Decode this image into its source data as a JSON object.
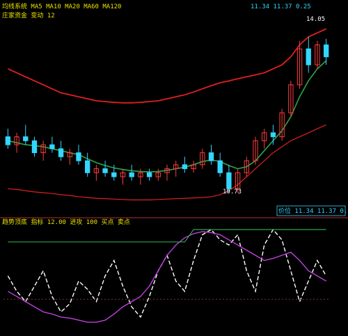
{
  "header": {
    "title_line": "均线系统 MA5 MA10 MA20 MA60 MA120",
    "sub_line": "庄家资金 变动 12",
    "right_line": "11.34 11.37 0.25"
  },
  "upper_panel": {
    "price_readout_high": "14.05",
    "price_readout_low": "10.73",
    "scale_box": "价位 11.34 11.37 0.25"
  },
  "lower_panel": {
    "title_line": "趋势顶底 指标 12.00 进攻 100 买点 卖点"
  },
  "colors": {
    "background": "#000000",
    "up_candle": "#ff3b3b",
    "down_candle": "#33d6ff",
    "band_red": "#e02020",
    "band_green": "#2aa84a",
    "ma_main": "#e8e000",
    "trend_white": "#ffffff",
    "trend_magenta": "#c040e0",
    "trend_green": "#2aa84a",
    "panel_border": "#b03030",
    "grid_dot": "#6a2a2a"
  },
  "chart_data": [
    {
      "type": "candlestick",
      "title": "",
      "ylim": [
        9.8,
        14.5
      ],
      "candles": [
        {
          "o": 11.6,
          "h": 11.8,
          "l": 11.3,
          "c": 11.4
        },
        {
          "o": 11.4,
          "h": 11.7,
          "l": 11.2,
          "c": 11.6
        },
        {
          "o": 11.6,
          "h": 11.9,
          "l": 11.4,
          "c": 11.5
        },
        {
          "o": 11.5,
          "h": 11.6,
          "l": 11.1,
          "c": 11.2
        },
        {
          "o": 11.2,
          "h": 11.5,
          "l": 11.0,
          "c": 11.4
        },
        {
          "o": 11.4,
          "h": 11.6,
          "l": 11.2,
          "c": 11.3
        },
        {
          "o": 11.3,
          "h": 11.5,
          "l": 11.0,
          "c": 11.1
        },
        {
          "o": 11.1,
          "h": 11.3,
          "l": 10.9,
          "c": 11.2
        },
        {
          "o": 11.2,
          "h": 11.4,
          "l": 10.9,
          "c": 11.0
        },
        {
          "o": 11.0,
          "h": 11.2,
          "l": 10.6,
          "c": 10.7
        },
        {
          "o": 10.7,
          "h": 10.9,
          "l": 10.5,
          "c": 10.8
        },
        {
          "o": 10.8,
          "h": 11.0,
          "l": 10.6,
          "c": 10.7
        },
        {
          "o": 10.7,
          "h": 10.9,
          "l": 10.5,
          "c": 10.6
        },
        {
          "o": 10.6,
          "h": 10.8,
          "l": 10.4,
          "c": 10.7
        },
        {
          "o": 10.7,
          "h": 10.9,
          "l": 10.5,
          "c": 10.6
        },
        {
          "o": 10.6,
          "h": 10.8,
          "l": 10.4,
          "c": 10.7
        },
        {
          "o": 10.7,
          "h": 10.8,
          "l": 10.5,
          "c": 10.6
        },
        {
          "o": 10.6,
          "h": 10.8,
          "l": 10.5,
          "c": 10.7
        },
        {
          "o": 10.7,
          "h": 10.9,
          "l": 10.5,
          "c": 10.8
        },
        {
          "o": 10.8,
          "h": 11.0,
          "l": 10.6,
          "c": 10.9
        },
        {
          "o": 10.9,
          "h": 11.1,
          "l": 10.7,
          "c": 10.8
        },
        {
          "o": 10.8,
          "h": 11.0,
          "l": 10.7,
          "c": 10.9
        },
        {
          "o": 10.9,
          "h": 11.3,
          "l": 10.8,
          "c": 11.2
        },
        {
          "o": 11.2,
          "h": 11.4,
          "l": 10.9,
          "c": 11.0
        },
        {
          "o": 11.0,
          "h": 11.2,
          "l": 10.6,
          "c": 10.7
        },
        {
          "o": 10.7,
          "h": 10.9,
          "l": 10.2,
          "c": 10.3
        },
        {
          "o": 10.3,
          "h": 10.8,
          "l": 10.2,
          "c": 10.7
        },
        {
          "o": 10.7,
          "h": 11.1,
          "l": 10.6,
          "c": 11.0
        },
        {
          "o": 11.0,
          "h": 11.6,
          "l": 10.9,
          "c": 11.5
        },
        {
          "o": 11.5,
          "h": 11.8,
          "l": 11.3,
          "c": 11.7
        },
        {
          "o": 11.7,
          "h": 11.9,
          "l": 11.4,
          "c": 11.6
        },
        {
          "o": 11.6,
          "h": 12.3,
          "l": 11.5,
          "c": 12.2
        },
        {
          "o": 12.2,
          "h": 13.0,
          "l": 12.1,
          "c": 12.9
        },
        {
          "o": 12.9,
          "h": 14.0,
          "l": 12.8,
          "c": 13.8
        },
        {
          "o": 13.8,
          "h": 14.1,
          "l": 13.2,
          "c": 13.4
        },
        {
          "o": 13.4,
          "h": 14.0,
          "l": 13.3,
          "c": 13.9
        },
        {
          "o": 13.9,
          "h": 14.05,
          "l": 13.4,
          "c": 13.6
        }
      ],
      "band_upper": [
        13.3,
        13.2,
        13.1,
        13.0,
        12.9,
        12.8,
        12.7,
        12.65,
        12.6,
        12.55,
        12.5,
        12.48,
        12.46,
        12.45,
        12.45,
        12.46,
        12.48,
        12.5,
        12.55,
        12.6,
        12.65,
        12.72,
        12.8,
        12.88,
        12.95,
        13.0,
        13.05,
        13.1,
        13.15,
        13.2,
        13.3,
        13.4,
        13.6,
        13.9,
        14.1,
        14.2,
        14.3
      ],
      "band_lower": [
        10.3,
        10.28,
        10.25,
        10.22,
        10.2,
        10.18,
        10.15,
        10.13,
        10.1,
        10.08,
        10.06,
        10.05,
        10.04,
        10.03,
        10.02,
        10.02,
        10.02,
        10.03,
        10.04,
        10.05,
        10.06,
        10.07,
        10.08,
        10.1,
        10.15,
        10.25,
        10.4,
        10.6,
        10.8,
        11.0,
        11.2,
        11.35,
        11.5,
        11.6,
        11.7,
        11.8,
        11.9
      ],
      "ma_main": [
        11.5,
        11.45,
        11.4,
        11.38,
        11.35,
        11.3,
        11.25,
        11.2,
        11.15,
        11.05,
        10.95,
        10.88,
        10.82,
        10.78,
        10.75,
        10.73,
        10.72,
        10.73,
        10.76,
        10.8,
        10.84,
        10.9,
        10.98,
        11.02,
        10.98,
        10.88,
        10.8,
        10.85,
        11.0,
        11.25,
        11.5,
        11.75,
        12.1,
        12.6,
        13.0,
        13.3,
        13.5
      ],
      "signals_low": [
        "10.73"
      ],
      "signals_high": [
        "14.05"
      ]
    },
    {
      "type": "line",
      "title": "",
      "ylim": [
        0,
        100
      ],
      "series": [
        {
          "values": [
            55,
            40,
            30,
            45,
            60,
            35,
            20,
            28,
            50,
            42,
            30,
            55,
            70,
            45,
            25,
            15,
            35,
            60,
            75,
            50,
            40,
            70,
            95,
            100,
            90,
            85,
            95,
            60,
            40,
            85,
            100,
            90,
            60,
            30,
            50,
            70,
            55
          ]
        },
        {
          "values": [
            40,
            35,
            30,
            25,
            20,
            18,
            15,
            14,
            12,
            10,
            10,
            12,
            18,
            25,
            30,
            35,
            45,
            60,
            75,
            85,
            92,
            96,
            98,
            97,
            95,
            90,
            85,
            80,
            75,
            70,
            72,
            75,
            78,
            70,
            60,
            55,
            50
          ]
        },
        {
          "values": [
            88,
            88,
            88,
            88,
            88,
            88,
            88,
            88,
            88,
            88,
            88,
            88,
            88,
            88,
            88,
            88,
            88,
            88,
            88,
            88,
            88,
            100,
            100,
            100,
            100,
            100,
            100,
            100,
            100,
            100,
            100,
            100,
            100,
            100,
            100,
            100,
            100
          ]
        }
      ],
      "hline": 12
    }
  ]
}
